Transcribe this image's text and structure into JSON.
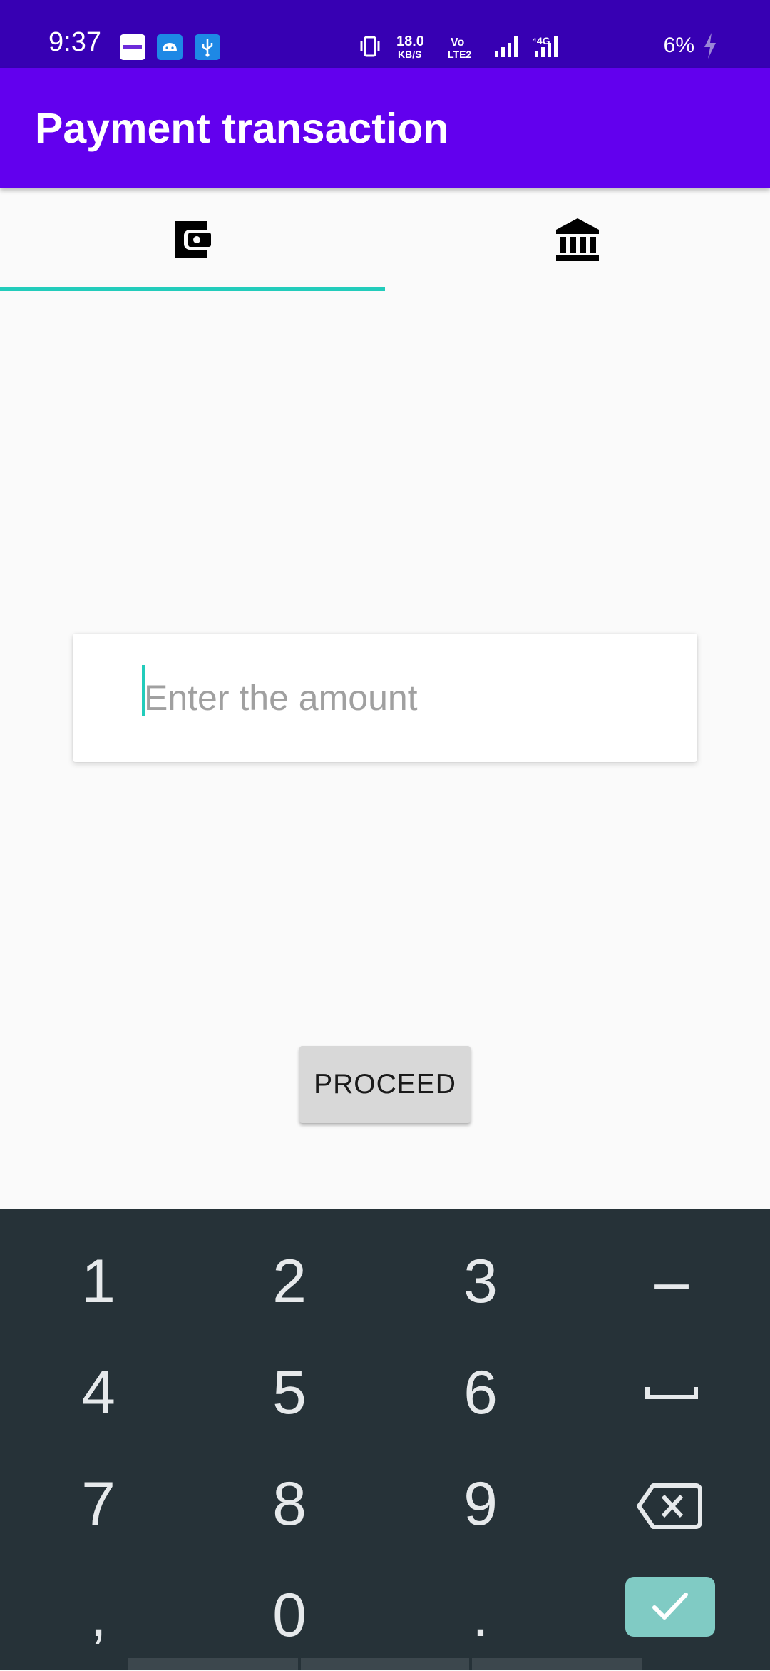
{
  "status_bar": {
    "time": "9:37",
    "battery": "6%",
    "icons": [
      "zomato-icon",
      "android-icon",
      "usb-icon",
      "vibrate-icon",
      "network-speed-icon",
      "volte-icon",
      "signal-icon",
      "4g-signal-icon",
      "charging-icon"
    ]
  },
  "app_bar": {
    "title": "Payment transaction"
  },
  "tabs": [
    {
      "icon": "wallet-icon",
      "selected": true
    },
    {
      "icon": "bank-icon",
      "selected": false
    }
  ],
  "amount_input": {
    "value": "",
    "placeholder": "Enter the amount"
  },
  "proceed_button": {
    "label": "PROCEED"
  },
  "keyboard": {
    "keys": [
      "1",
      "2",
      "3",
      "–",
      "4",
      "5",
      "6",
      "7",
      "8",
      "9",
      ",",
      "0",
      "."
    ],
    "icons": [
      "space-icon",
      "backspace-icon",
      "checkmark-icon"
    ]
  },
  "colors": {
    "status_bar": "#3700b3",
    "app_bar": "#6200ee",
    "accent": "#22ccbb",
    "keyboard_bg": "#263238",
    "done_key": "#80cbc4"
  }
}
